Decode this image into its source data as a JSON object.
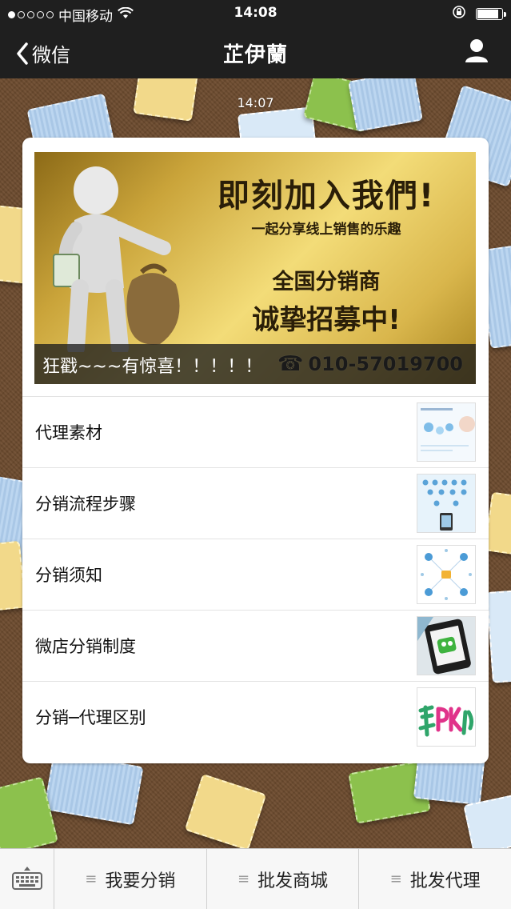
{
  "status_bar": {
    "carrier": "中国移动",
    "time": "14:08"
  },
  "nav": {
    "back_label": "微信",
    "title": "芷伊蘭"
  },
  "chat": {
    "timestamp": "14:07"
  },
  "article": {
    "cover": {
      "headline": "即刻加入我們!",
      "subline": "一起分享线上销售的乐趣",
      "line3": "全国分销商",
      "line4": "诚挚招募中!",
      "caption": "狂戳~~~有惊喜！！！！！",
      "phone": "010-57019700"
    },
    "items": [
      {
        "label": "代理素材",
        "thumb_icon": "brochure-thumbnail"
      },
      {
        "label": "分销流程步骤",
        "thumb_icon": "network-diagram-thumbnail"
      },
      {
        "label": "分销须知",
        "thumb_icon": "hub-diagram-thumbnail"
      },
      {
        "label": "微店分销制度",
        "thumb_icon": "wechat-phone-thumbnail"
      },
      {
        "label": "分销─代理区别",
        "thumb_icon": "pk-text-thumbnail"
      }
    ]
  },
  "bottom_menu": {
    "items": [
      {
        "label": "我要分销"
      },
      {
        "label": "批发商城"
      },
      {
        "label": "批发代理"
      }
    ]
  },
  "colors": {
    "bar_bg": "#1f1f1f",
    "card_bg": "#ffffff",
    "menu_bg": "#f7f7f7"
  }
}
